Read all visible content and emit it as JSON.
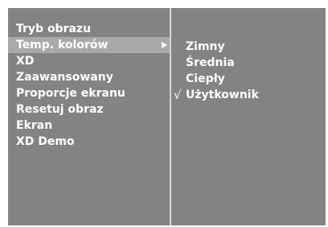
{
  "menu": {
    "items": [
      {
        "label": "Tryb obrazu"
      },
      {
        "label": "Temp. kolorów",
        "selected": true,
        "has_submenu": true
      },
      {
        "label": "XD"
      },
      {
        "label": "Zaawansowany"
      },
      {
        "label": "Proporcje ekranu"
      },
      {
        "label": "Resetuj obraz"
      },
      {
        "label": "Ekran"
      },
      {
        "label": "XD Demo"
      }
    ],
    "submenu_arrow_icon": "triangle-right-icon"
  },
  "submenu": {
    "items": [
      {
        "label": "Zimny"
      },
      {
        "label": "Średnia"
      },
      {
        "label": "Ciepły"
      },
      {
        "label": "Użytkownik",
        "checked": true
      }
    ],
    "check_icon": "√"
  },
  "colors": {
    "panel": "#838383",
    "highlight": "#a9a9a9",
    "divider": "#d6d6d6",
    "text": "#ffffff"
  }
}
